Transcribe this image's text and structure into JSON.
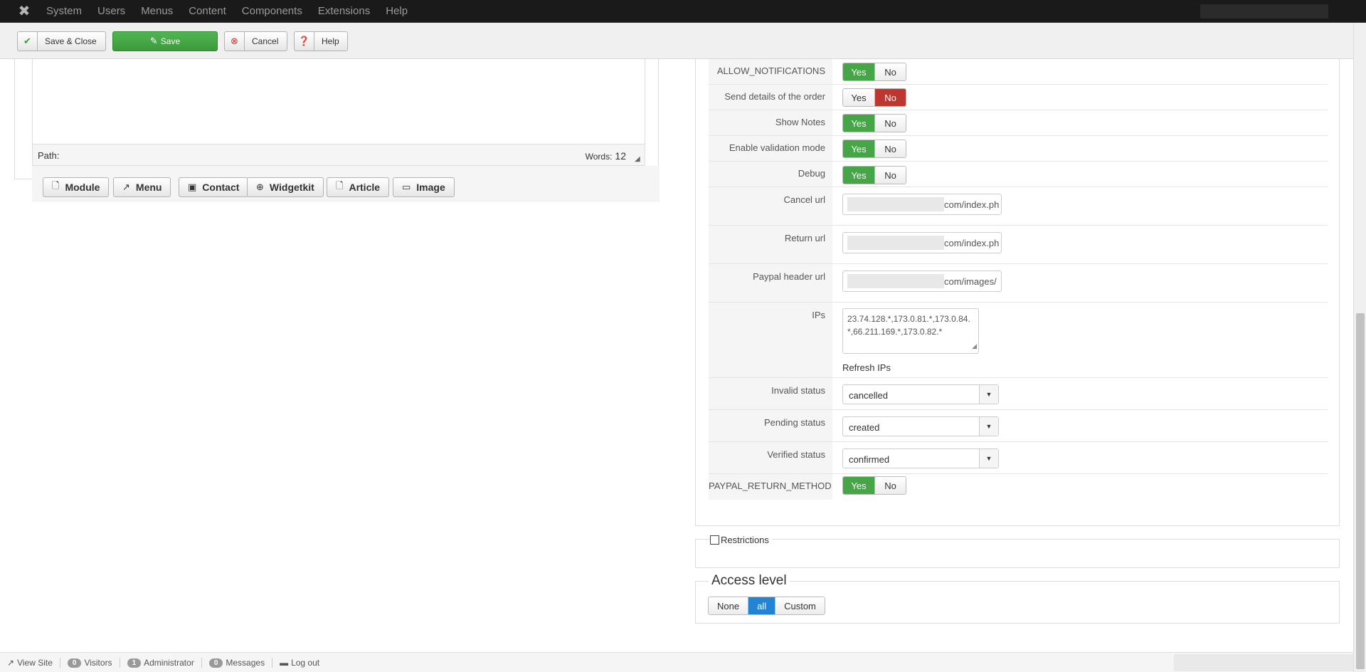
{
  "topnav": {
    "logo_icon": "joomla-logo-icon",
    "menu": [
      "System",
      "Users",
      "Menus",
      "Content",
      "Components",
      "Extensions",
      "Help"
    ]
  },
  "toolbar": {
    "save_close": "Save & Close",
    "save": "Save",
    "cancel": "Cancel",
    "help": "Help"
  },
  "editor": {
    "path_label": "Path:",
    "words_label": "Words:",
    "words_count": "12",
    "buttons": [
      "Module",
      "Menu",
      "Contact",
      "Widgetkit",
      "Article",
      "Image"
    ]
  },
  "params": {
    "yes": "Yes",
    "no": "No",
    "allow_notifications": {
      "label": "ALLOW_NOTIFICATIONS",
      "value": "Yes"
    },
    "send_details": {
      "label": "Send details of the order",
      "value": "No"
    },
    "show_notes": {
      "label": "Show Notes",
      "value": "Yes"
    },
    "validation_mode": {
      "label": "Enable validation mode",
      "value": "Yes"
    },
    "debug": {
      "label": "Debug",
      "value": "Yes"
    },
    "cancel_url": {
      "label": "Cancel url",
      "value": "com/index.ph"
    },
    "return_url": {
      "label": "Return url",
      "value": "com/index.ph"
    },
    "header_url": {
      "label": "Paypal header url",
      "value": "com/images/"
    },
    "ips": {
      "label": "IPs",
      "value": "23.74.128.*,173.0.81.*,173.0.84.*,66.211.169.*,173.0.82.*",
      "refresh": "Refresh IPs"
    },
    "invalid_status": {
      "label": "Invalid status",
      "value": "cancelled"
    },
    "pending_status": {
      "label": "Pending status",
      "value": "created"
    },
    "verified_status": {
      "label": "Verified status",
      "value": "confirmed"
    },
    "return_method": {
      "label": "PAYPAL_RETURN_METHOD",
      "value": "Yes"
    }
  },
  "restrictions": {
    "label": "Restrictions"
  },
  "access": {
    "legend": "Access level",
    "options": [
      "None",
      "all",
      "Custom"
    ],
    "selected": "all"
  },
  "statusbar": {
    "view_site": "View Site",
    "visitors_count": "0",
    "visitors_label": "Visitors",
    "admin_count": "1",
    "admin_label": "Administrator",
    "messages_count": "0",
    "messages_label": "Messages",
    "logout": "Log out"
  },
  "colors": {
    "yes_active": "#46a546",
    "no_active": "#bd362f",
    "access_active": "#2384d3",
    "save_button": "#46a546"
  }
}
